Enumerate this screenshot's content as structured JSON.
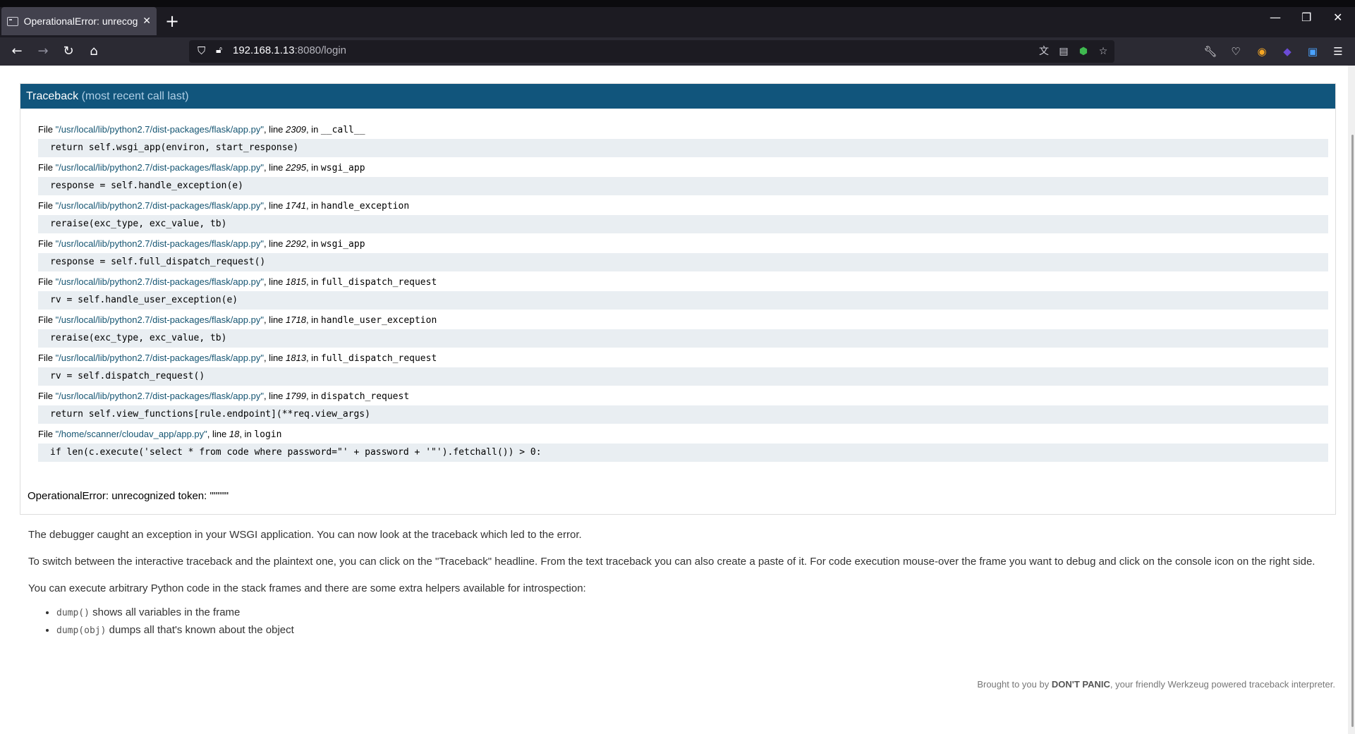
{
  "browser": {
    "tab_title": "OperationalError: unrecognized token",
    "url_host": "192.168.1.13",
    "url_path": ":8080/login"
  },
  "traceback": {
    "header": "Traceback",
    "header_sub": "(most recent call last)",
    "frames": [
      {
        "file": "\"/usr/local/lib/python2.7/dist-packages/flask/app.py\"",
        "line": "2309",
        "func": "__call__",
        "code": "return self.wsgi_app(environ, start_response)"
      },
      {
        "file": "\"/usr/local/lib/python2.7/dist-packages/flask/app.py\"",
        "line": "2295",
        "func": "wsgi_app",
        "code": "response = self.handle_exception(e)"
      },
      {
        "file": "\"/usr/local/lib/python2.7/dist-packages/flask/app.py\"",
        "line": "1741",
        "func": "handle_exception",
        "code": "reraise(exc_type, exc_value, tb)"
      },
      {
        "file": "\"/usr/local/lib/python2.7/dist-packages/flask/app.py\"",
        "line": "2292",
        "func": "wsgi_app",
        "code": "response = self.full_dispatch_request()"
      },
      {
        "file": "\"/usr/local/lib/python2.7/dist-packages/flask/app.py\"",
        "line": "1815",
        "func": "full_dispatch_request",
        "code": "rv = self.handle_user_exception(e)"
      },
      {
        "file": "\"/usr/local/lib/python2.7/dist-packages/flask/app.py\"",
        "line": "1718",
        "func": "handle_user_exception",
        "code": "reraise(exc_type, exc_value, tb)"
      },
      {
        "file": "\"/usr/local/lib/python2.7/dist-packages/flask/app.py\"",
        "line": "1813",
        "func": "full_dispatch_request",
        "code": "rv = self.dispatch_request()"
      },
      {
        "file": "\"/usr/local/lib/python2.7/dist-packages/flask/app.py\"",
        "line": "1799",
        "func": "dispatch_request",
        "code": "return self.view_functions[rule.endpoint](**req.view_args)"
      },
      {
        "file": "\"/home/scanner/cloudav_app/app.py\"",
        "line": "18",
        "func": "login",
        "code": "if len(c.execute('select * from code where password=\"' + password + '\"').fetchall()) > 0:"
      }
    ],
    "labels": {
      "file": "File ",
      "line": ", line ",
      "in": ", in "
    },
    "error": "OperationalError: unrecognized token: \"\"\"\"\""
  },
  "explain": {
    "p1": "The debugger caught an exception in your WSGI application. You can now look at the traceback which led to the error.",
    "p2": "To switch between the interactive traceback and the plaintext one, you can click on the \"Traceback\" headline. From the text traceback you can also create a paste of it. For code execution mouse-over the frame you want to debug and click on the console icon on the right side.",
    "p3": "You can execute arbitrary Python code in the stack frames and there are some extra helpers available for introspection:",
    "helpers": [
      {
        "code": "dump()",
        "text": " shows all variables in the frame"
      },
      {
        "code": "dump(obj)",
        "text": " dumps all that's known about the object"
      }
    ]
  },
  "footer": {
    "pre": "Brought to you by ",
    "brand": "DON'T PANIC",
    "post": ", your friendly Werkzeug powered traceback interpreter."
  }
}
